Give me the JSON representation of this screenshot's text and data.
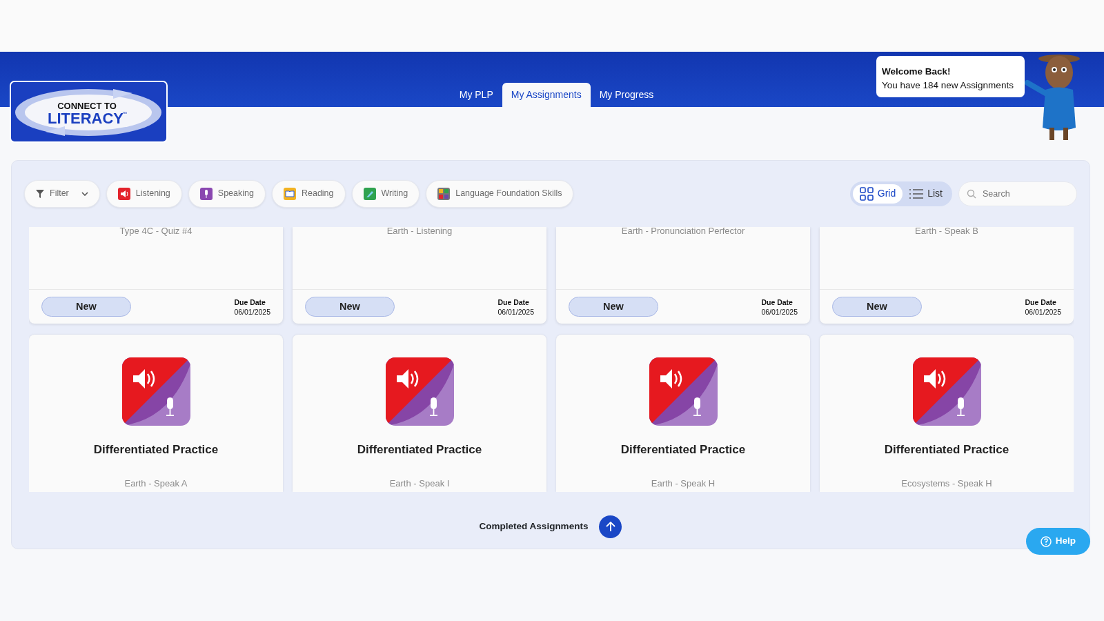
{
  "logo": {
    "line1": "CONNECT TO",
    "line2": "LITERACY",
    "mark": "™"
  },
  "tabs": [
    {
      "label": "My PLP",
      "selected": false
    },
    {
      "label": "My Assignments",
      "selected": true
    },
    {
      "label": "My Progress",
      "selected": false
    }
  ],
  "welcome": {
    "title": "Welcome Back!",
    "message": "You have 184 new Assignments"
  },
  "filter": {
    "label": "Filter"
  },
  "categories": [
    {
      "label": "Listening",
      "kind": "speaker",
      "color": "#e3232b"
    },
    {
      "label": "Speaking",
      "kind": "mic",
      "color": "#8a47b0"
    },
    {
      "label": "Reading",
      "kind": "book",
      "color": "#f2b221"
    },
    {
      "label": "Writing",
      "kind": "pencil",
      "color": "#2fa24f"
    },
    {
      "label": "Language Foundation Skills",
      "kind": "quad",
      "color": "#6b4aa8"
    }
  ],
  "view_toggle": [
    {
      "label": "Grid",
      "kind": "grid",
      "selected": true
    },
    {
      "label": "List",
      "kind": "list",
      "selected": false
    }
  ],
  "search": {
    "placeholder": "Search"
  },
  "cards_top_row": [
    {
      "subtitle": "Type 4C - Quiz #4",
      "status": "New",
      "due_label": "Due Date",
      "due_date": "06/01/2025"
    },
    {
      "subtitle": "Earth - Listening",
      "status": "New",
      "due_label": "Due Date",
      "due_date": "06/01/2025"
    },
    {
      "subtitle": "Earth - Pronunciation Perfector",
      "status": "New",
      "due_label": "Due Date",
      "due_date": "06/01/2025"
    },
    {
      "subtitle": "Earth - Speak B",
      "status": "New",
      "due_label": "Due Date",
      "due_date": "06/01/2025"
    }
  ],
  "cards_bottom_row": [
    {
      "title": "Differentiated Practice",
      "subtitle": "Earth - Speak A"
    },
    {
      "title": "Differentiated Practice",
      "subtitle": "Earth - Speak I"
    },
    {
      "title": "Differentiated Practice",
      "subtitle": "Earth - Speak H"
    },
    {
      "title": "Differentiated Practice",
      "subtitle": "Ecosystems - Speak H"
    }
  ],
  "completed": {
    "label": "Completed Assignments"
  },
  "help": {
    "label": "Help"
  }
}
